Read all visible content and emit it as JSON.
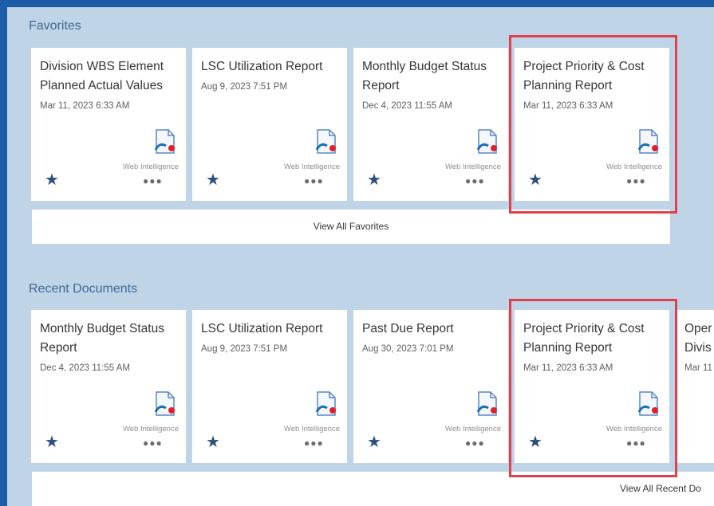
{
  "favorites": {
    "heading": "Favorites",
    "cards": [
      {
        "title": "Division WBS Element Planned Actual Values",
        "date": "Mar 11, 2023 6:33 AM",
        "type": "Web Intelligence"
      },
      {
        "title": "LSC Utilization Report",
        "date": "Aug 9, 2023 7:51 PM",
        "type": "Web Intelligence"
      },
      {
        "title": "Monthly Budget Status Report",
        "date": "Dec 4, 2023 11:55 AM",
        "type": "Web Intelligence"
      },
      {
        "title": "Project Priority & Cost Planning Report",
        "date": "Mar 11, 2023 6:33 AM",
        "type": "Web Intelligence"
      }
    ],
    "view_all_label": "View All Favorites"
  },
  "recent": {
    "heading": "Recent Documents",
    "cards": [
      {
        "title": "Monthly Budget Status Report",
        "date": "Dec 4, 2023 11:55 AM",
        "type": "Web Intelligence"
      },
      {
        "title": "LSC Utilization Report",
        "date": "Aug 9, 2023 7:51 PM",
        "type": "Web Intelligence"
      },
      {
        "title": "Past Due Report",
        "date": "Aug 30, 2023 7:01 PM",
        "type": "Web Intelligence"
      },
      {
        "title": "Project Priority & Cost Planning Report",
        "date": "Mar 11, 2023 6:33 AM",
        "type": "Web Intelligence"
      },
      {
        "title": "Oper Divis",
        "date": "Mar 11",
        "type": "Web Intelligence"
      }
    ],
    "view_all_label": "View All Recent Do"
  },
  "icons": {
    "star": "star-icon",
    "more": "more-icon",
    "document": "web-intelligence-doc-icon"
  },
  "colors": {
    "highlight": "#e0404a",
    "favorite_star": "#2c4f7c",
    "header_band": "#1b5da6",
    "panel_bg": "#bfd4e6"
  },
  "glyphs": {
    "star": "★",
    "more": "●●●"
  }
}
